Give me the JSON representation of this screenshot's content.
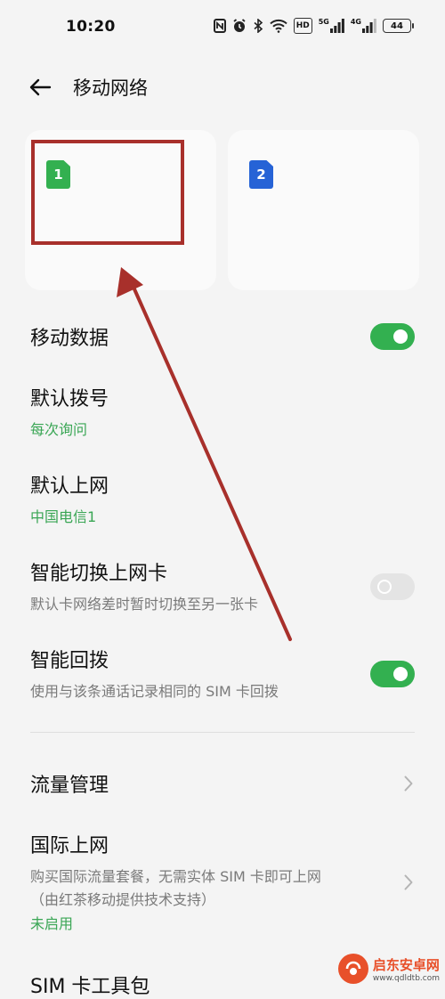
{
  "status_bar": {
    "time": "10:20",
    "icons": [
      "nfc-icon",
      "alarm-icon",
      "bluetooth-icon",
      "wifi-icon",
      "hd-icon",
      "signal-5g-icon",
      "signal-4g-icon"
    ],
    "hd_label": "HD",
    "sig1_label": "5G",
    "sig2_label": "4G",
    "battery": "44"
  },
  "header": {
    "title": "移动网络"
  },
  "sim_cards": [
    {
      "number": "1",
      "color": "#33b050"
    },
    {
      "number": "2",
      "color": "#2663d6"
    }
  ],
  "settings": {
    "mobile_data": {
      "title": "移动数据",
      "on": true
    },
    "default_dial": {
      "title": "默认拨号",
      "value": "每次询问"
    },
    "default_data": {
      "title": "默认上网",
      "value": "中国电信1"
    },
    "smart_switch": {
      "title": "智能切换上网卡",
      "desc": "默认卡网络差时暂时切换至另一张卡",
      "on": false
    },
    "smart_callback": {
      "title": "智能回拨",
      "desc": "使用与该条通话记录相同的 SIM 卡回拨",
      "on": true
    },
    "data_management": {
      "title": "流量管理"
    },
    "intl_roaming": {
      "title": "国际上网",
      "desc1": "购买国际流量套餐，无需实体 SIM 卡即可上网",
      "desc2": "（由红茶移动提供技术支持）",
      "status": "未启用"
    },
    "sim_toolkit": {
      "title": "SIM 卡工具包"
    }
  },
  "annotation": {
    "color": "#a8302b"
  },
  "watermark": {
    "name": "启东安卓网",
    "url": "www.qdldtb.com"
  }
}
